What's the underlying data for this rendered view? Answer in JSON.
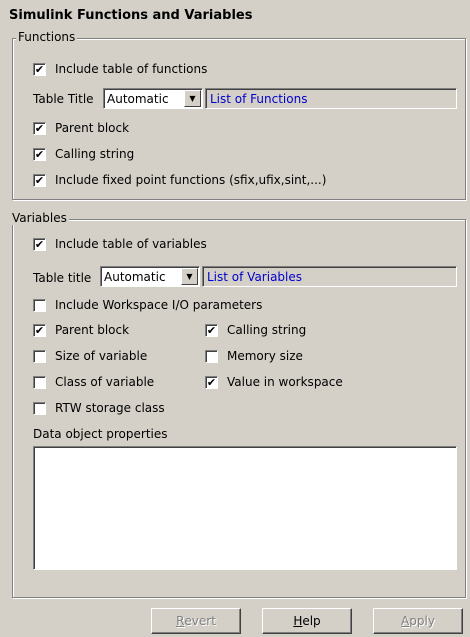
{
  "title": "Simulink Functions and Variables",
  "functions": {
    "legend": "Functions",
    "include_table": {
      "label": "Include table of functions",
      "checked": true
    },
    "table_title_label": "Table Title",
    "table_title_mode": "Automatic",
    "table_title_value": "List of Functions",
    "options": [
      {
        "label": "Parent block",
        "checked": true
      },
      {
        "label": "Calling string",
        "checked": true
      },
      {
        "label": "Include fixed point functions (sfix,ufix,sint,...)",
        "checked": true
      }
    ]
  },
  "variables": {
    "legend": "Variables",
    "include_table": {
      "label": "Include table of variables",
      "checked": true
    },
    "table_title_label": "Table title",
    "table_title_mode": "Automatic",
    "table_title_value": "List of Variables",
    "workspace_io": {
      "label": "Include Workspace I/O parameters",
      "checked": false
    },
    "left_options": [
      {
        "label": "Parent block",
        "checked": true
      },
      {
        "label": "Size of variable",
        "checked": false
      },
      {
        "label": "Class of variable",
        "checked": false
      },
      {
        "label": "RTW storage class",
        "checked": false
      }
    ],
    "right_options": [
      {
        "label": "Calling string",
        "checked": true
      },
      {
        "label": "Memory size",
        "checked": false
      },
      {
        "label": "Value in workspace",
        "checked": true
      }
    ],
    "data_object_label": "Data object properties",
    "data_object_value": ""
  },
  "buttons": {
    "revert": {
      "prefix": "",
      "mnemonic": "R",
      "rest": "evert"
    },
    "help": {
      "prefix": "",
      "mnemonic": "H",
      "rest": "elp"
    },
    "apply": {
      "prefix": "",
      "mnemonic": "A",
      "rest": "pply"
    }
  },
  "icons": {
    "check": "✔",
    "dropdown": "▼"
  },
  "colors": {
    "face": "#d4d0c8",
    "link_text": "#0000cc"
  }
}
